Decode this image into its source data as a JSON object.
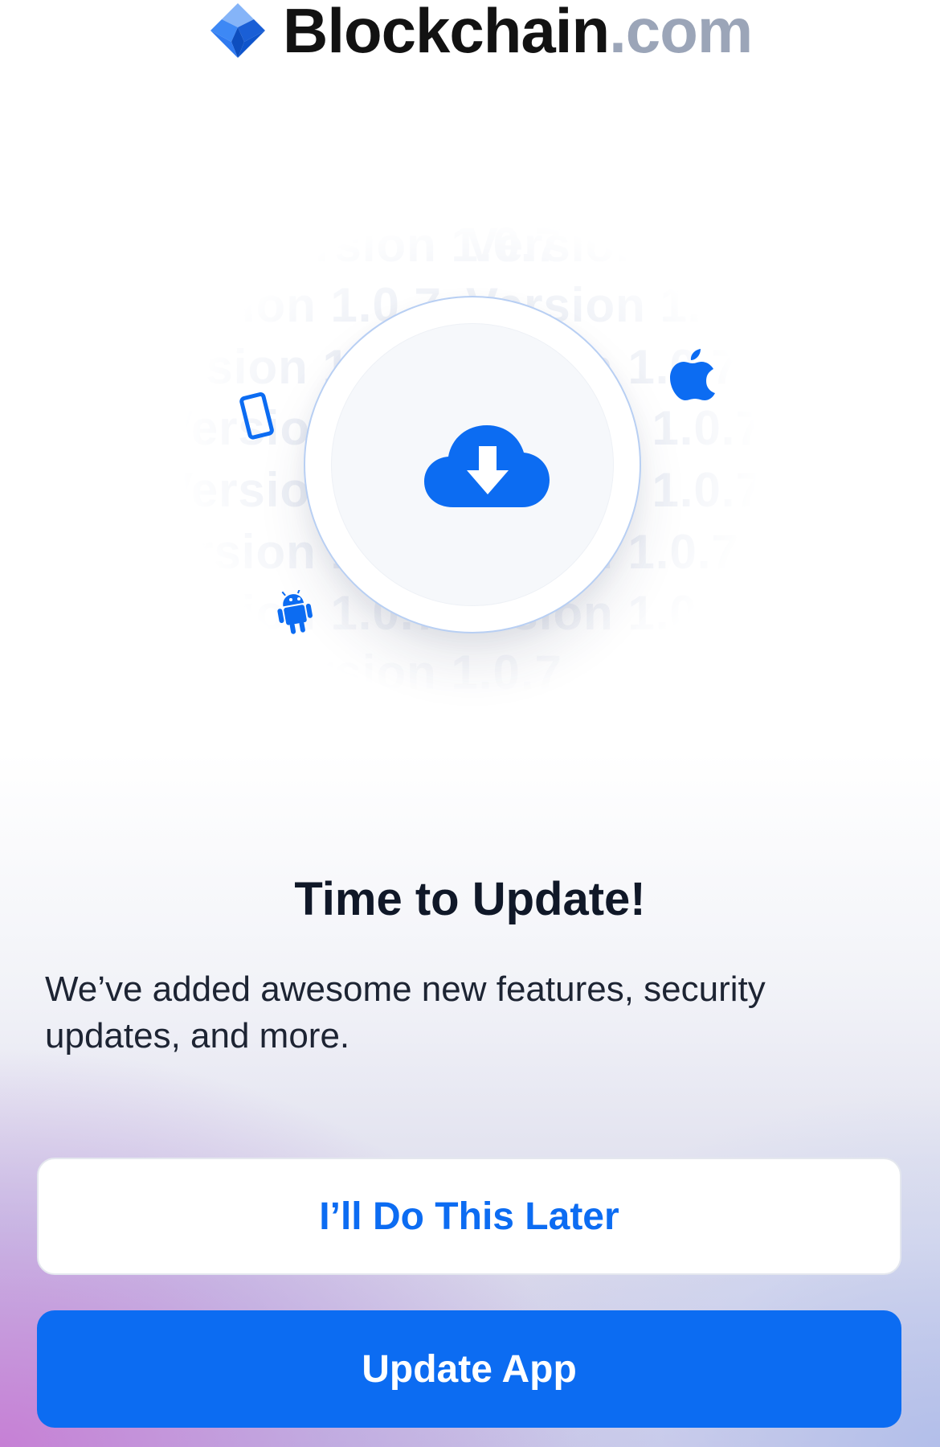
{
  "brand": {
    "name": "Blockchain",
    "tld": ".com"
  },
  "hero": {
    "version_text": "Version 1.0.7",
    "icons": [
      "cloud-download-icon",
      "phone-icon",
      "apple-icon",
      "android-icon"
    ]
  },
  "content": {
    "title": "Time to Update!",
    "description": "We’ve added awesome new features, security updates, and more."
  },
  "actions": {
    "later_label": "I’ll Do This Later",
    "update_label": "Update App"
  },
  "colors": {
    "accent": "#0C6CF2",
    "brand_tld": "#9BA5B8",
    "title_text": "#101828"
  }
}
